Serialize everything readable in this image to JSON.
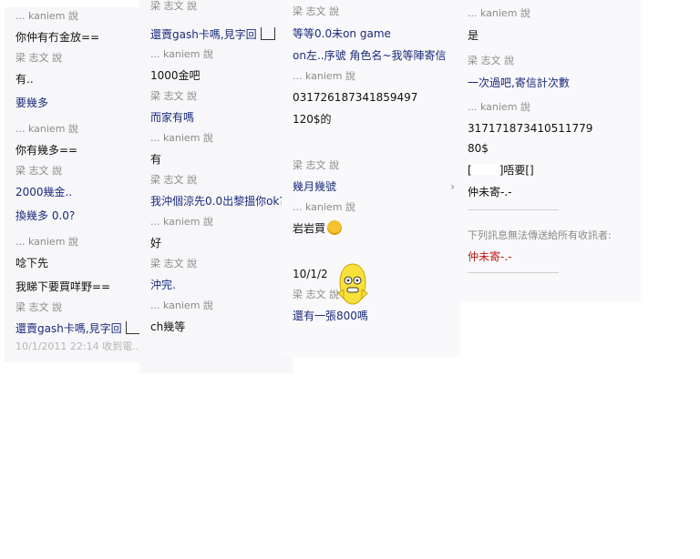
{
  "col1": {
    "entries": [
      {
        "sender": "... kaniem 說",
        "lines": [
          {
            "text": "你仲有冇金放==",
            "color": "black"
          }
        ]
      },
      {
        "sender": "梁 志文 說",
        "lines": [
          {
            "text": "有..",
            "color": "black"
          },
          {
            "text": "要幾多",
            "color": "blue"
          }
        ]
      },
      {
        "sender": "... kaniem 說",
        "lines": [
          {
            "text": "你有幾多==",
            "color": "black"
          }
        ]
      },
      {
        "sender": "梁 志文 說",
        "lines": [
          {
            "text": "2000幾金..",
            "color": "blue"
          },
          {
            "text": "換幾多 0.0?",
            "color": "blue"
          }
        ]
      },
      {
        "sender": "... kaniem 說",
        "lines": [
          {
            "text": "唸下先",
            "color": "black"
          },
          {
            "text": "我睇下要買咩野==",
            "color": "black"
          }
        ]
      },
      {
        "sender": "梁 志文 說",
        "lines": [
          {
            "text": "還賣gash卡嗎,見字回",
            "color": "blue"
          }
        ]
      }
    ],
    "footer": "10/1/2011 22:14 收到電..."
  },
  "col2": {
    "entries": [
      {
        "sender": "梁 志文 說",
        "lines": [
          {
            "text": "還賣gash卡嗎,見字回",
            "color": "blue"
          }
        ]
      },
      {
        "sender": "... kaniem 說",
        "lines": [
          {
            "text": "1000金吧",
            "color": "black"
          }
        ]
      },
      {
        "sender": "梁 志文 說",
        "lines": [
          {
            "text": "而家有嗎",
            "color": "blue"
          }
        ]
      },
      {
        "sender": "... kaniem 說",
        "lines": [
          {
            "text": "有",
            "color": "black"
          }
        ]
      },
      {
        "sender": "梁 志文 說",
        "lines": [
          {
            "text": "我沖個涼先0.0出黎搵你ok?",
            "color": "blue"
          }
        ]
      },
      {
        "sender": "... kaniem 說",
        "lines": [
          {
            "text": "好",
            "color": "black"
          }
        ]
      },
      {
        "sender": "梁 志文 說",
        "lines": [
          {
            "text": "沖完.",
            "color": "blue"
          }
        ]
      },
      {
        "sender": "... kaniem 說",
        "lines": [
          {
            "text": "ch幾等",
            "color": "black"
          }
        ]
      }
    ]
  },
  "col3": {
    "top_lines": [
      {
        "text": "梁 志文 說",
        "color": "gray"
      },
      {
        "text": "等等0.0未on game",
        "color": "blue"
      },
      {
        "text": "on左..序號  角色名~我等陣寄信",
        "color": "blue"
      }
    ],
    "entries": [
      {
        "sender": "... kaniem 說",
        "lines": [
          {
            "text": "031726187341859497",
            "color": "black"
          },
          {
            "text": "120$的",
            "color": "black"
          }
        ]
      },
      {
        "sender": "梁 志文 說",
        "lines": [
          {
            "text": "幾月幾號",
            "color": "blue"
          }
        ]
      },
      {
        "sender": "... kaniem 說",
        "lines": [
          {
            "text": "岩岩買",
            "color": "black"
          }
        ]
      }
    ],
    "date_line": "10/1/2",
    "last_sender": "梁 志文 說",
    "last_line": "還有一張800嗎"
  },
  "col4": {
    "entries": [
      {
        "sender": "... kaniem 說",
        "lines": [
          {
            "text": "是",
            "color": "black"
          }
        ]
      },
      {
        "sender": "梁 志文 說",
        "lines": [
          {
            "text": "一次過吧,寄信計次數",
            "color": "blue"
          }
        ]
      },
      {
        "sender": "... kaniem 說",
        "lines": [
          {
            "text": "317171873410511779",
            "color": "black"
          },
          {
            "text": "80$",
            "color": "black"
          }
        ]
      }
    ],
    "bracket_line_left": "[",
    "bracket_line_right": "]唔要[]",
    "line_after": "仲未寄-.-",
    "notice": "下列訊息無法傳送給所有收訊者:",
    "failed_message": "仲未寄-.-"
  },
  "colors": {
    "blue": "#1a2a7a",
    "red": "#c01818",
    "sender_gray": "#8a8a8a",
    "panel_bg": "#f7f7f9"
  }
}
